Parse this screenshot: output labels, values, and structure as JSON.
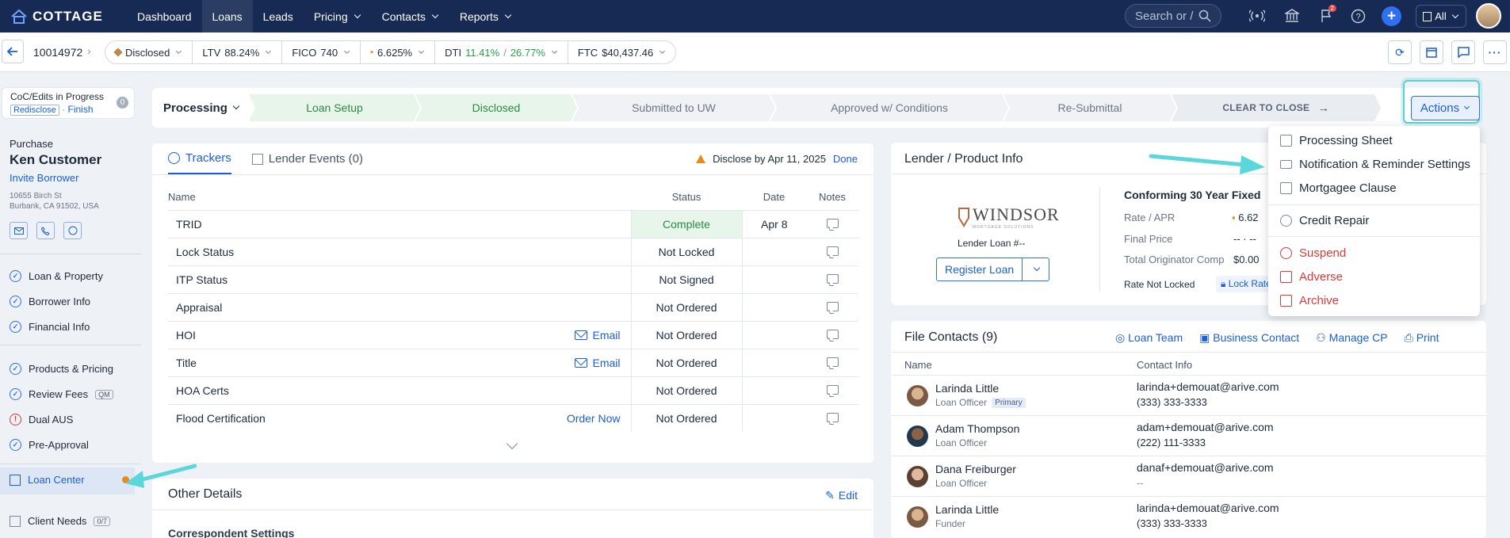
{
  "nav": {
    "logo": "COTTAGE",
    "items": [
      {
        "label": "Dashboard"
      },
      {
        "label": "Loans"
      },
      {
        "label": "Leads"
      },
      {
        "label": "Pricing"
      },
      {
        "label": "Contacts"
      },
      {
        "label": "Reports"
      }
    ],
    "search_placeholder": "Search or /",
    "notification_count": "2",
    "scope_label": "All"
  },
  "loanbar": {
    "loan_number": "10014972",
    "status": "Disclosed",
    "ltv_label": "LTV",
    "ltv_value": "88.24%",
    "fico_label": "FICO",
    "fico_value": "740",
    "rate": "6.625%",
    "dti_label": "DTI",
    "dti_front": "11.41%",
    "dti_sep": "/",
    "dti_back": "26.77%",
    "ftc_label": "FTC",
    "ftc_value": "$40,437.46"
  },
  "sidebar": {
    "coc_title": "CoC/Edits in Progress",
    "coc_redisclose": "Redisclose",
    "coc_dot": "·",
    "coc_finish": "Finish",
    "coc_count": "0",
    "loan_type": "Purchase",
    "customer": "Ken Customer",
    "invite": "Invite Borrower",
    "address_line1": "10655 Birch St",
    "address_line2": "Burbank, CA 91502, USA",
    "items": [
      {
        "label": "Loan & Property"
      },
      {
        "label": "Borrower Info"
      },
      {
        "label": "Financial Info"
      },
      {
        "label": "Products & Pricing"
      },
      {
        "label": "Review Fees",
        "tag": "QM"
      },
      {
        "label": "Dual AUS"
      },
      {
        "label": "Pre-Approval"
      },
      {
        "label": "Loan Center"
      },
      {
        "label": "Client Needs",
        "tag": "0/7"
      }
    ]
  },
  "progress": {
    "current": "Processing",
    "stages": [
      "Loan Setup",
      "Disclosed",
      "Submitted to UW",
      "Approved w/ Conditions",
      "Re-Submittal",
      "CLEAR TO CLOSE"
    ],
    "actions_label": "Actions"
  },
  "actions_menu": [
    "Processing Sheet",
    "Notification & Reminder Settings",
    "Mortgagee Clause",
    "Credit Repair",
    "Suspend",
    "Adverse",
    "Archive"
  ],
  "trackers": {
    "tab_trackers": "Trackers",
    "tab_lender": "Lender Events (0)",
    "disclose_by": "Disclose by Apr 11, 2025",
    "done": "Done",
    "headers": [
      "Name",
      "Status",
      "Date",
      "Notes"
    ],
    "rows": [
      {
        "name": "TRID",
        "status": "Complete",
        "date": "Apr 8",
        "link": ""
      },
      {
        "name": "Lock Status",
        "status": "Not Locked",
        "date": "",
        "link": ""
      },
      {
        "name": "ITP Status",
        "status": "Not Signed",
        "date": "",
        "link": ""
      },
      {
        "name": "Appraisal",
        "status": "Not Ordered",
        "date": "",
        "link": ""
      },
      {
        "name": "HOI",
        "status": "Not Ordered",
        "date": "",
        "link": "Email"
      },
      {
        "name": "Title",
        "status": "Not Ordered",
        "date": "",
        "link": "Email"
      },
      {
        "name": "HOA Certs",
        "status": "Not Ordered",
        "date": "",
        "link": ""
      },
      {
        "name": "Flood Certification",
        "status": "Not Ordered",
        "date": "",
        "link": "Order Now"
      }
    ]
  },
  "other_details": {
    "title": "Other Details",
    "edit": "Edit",
    "sub": "Correspondent Settings"
  },
  "lender": {
    "title": "Lender / Product Info",
    "logo_text": "WINDSOR",
    "logo_sub": "MORTGAGE SOLUTIONS",
    "loan_num": "Lender Loan #--",
    "register": "Register Loan",
    "product": "Conforming 30 Year Fixed",
    "rate_label": "Rate / APR",
    "rate_value": "6.62",
    "final_price_label": "Final Price",
    "final_price_value": "-- · --",
    "comp_label": "Total Originator Comp",
    "comp_value": "$0.00",
    "lock_status": "Rate Not Locked",
    "lock_link": "Lock Rate"
  },
  "file_contacts": {
    "title": "File Contacts (9)",
    "loan_team": "Loan Team",
    "business_contact": "Business Contact",
    "manage_cp": "Manage CP",
    "print": "Print",
    "col_name": "Name",
    "col_contact": "Contact Info",
    "rows": [
      {
        "name": "Larinda Little",
        "role": "Loan Officer",
        "tag": "Primary",
        "email": "larinda+demouat@arive.com",
        "phone": "(333) 333-3333"
      },
      {
        "name": "Adam Thompson",
        "role": "Loan Officer",
        "tag": "",
        "email": "adam+demouat@arive.com",
        "phone": "(222) 111-3333"
      },
      {
        "name": "Dana Freiburger",
        "role": "Loan Officer",
        "tag": "",
        "email": "danaf+demouat@arive.com",
        "phone": "--"
      },
      {
        "name": "Larinda Little",
        "role": "Funder",
        "tag": "",
        "email": "larinda+demouat@arive.com",
        "phone": "(333) 333-3333"
      }
    ]
  },
  "colors": {
    "nav_bg": "#172a53",
    "accent": "#1b5fd6",
    "highlight": "#5bcfd6",
    "danger": "#d83b3b",
    "success": "#2a9d4a"
  }
}
